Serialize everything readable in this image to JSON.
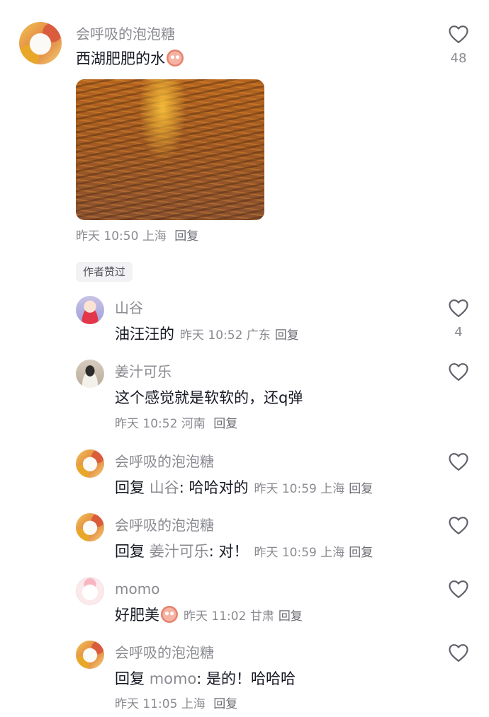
{
  "comments": [
    {
      "user": "会呼吸的泡泡糖",
      "text": "西湖肥肥的水",
      "meta": {
        "time": "昨天 10:50",
        "location": "上海",
        "reply": "回复"
      },
      "likes": "48",
      "author_tag": "作者赞过"
    },
    {
      "user": "山谷",
      "text": "油汪汪的",
      "meta": {
        "time": "昨天 10:52",
        "location": "广东",
        "reply": "回复"
      },
      "likes": "4"
    },
    {
      "user": "姜汁可乐",
      "text": "这个感觉就是软软的，还q弹",
      "meta": {
        "time": "昨天 10:52",
        "location": "河南",
        "reply": "回复"
      }
    },
    {
      "user": "会呼吸的泡泡糖",
      "reply_label": "回复",
      "reply_to": "山谷",
      "text": ": 哈哈对的",
      "meta": {
        "time": "昨天 10:59",
        "location": "上海",
        "reply": "回复"
      }
    },
    {
      "user": "会呼吸的泡泡糖",
      "reply_label": "回复",
      "reply_to": "姜汁可乐",
      "text": ": 对！",
      "meta": {
        "time": "昨天 10:59",
        "location": "上海",
        "reply": "回复"
      }
    },
    {
      "user": "momo",
      "text": "好肥美",
      "meta": {
        "time": "昨天 11:02",
        "location": "甘肃",
        "reply": "回复"
      }
    },
    {
      "user": "会呼吸的泡泡糖",
      "reply_label": "回复",
      "reply_to": "momo",
      "text": ": 是的！哈哈哈",
      "meta": {
        "time": "昨天 11:05",
        "location": "上海",
        "reply": "回复"
      }
    }
  ],
  "icons": {
    "like": "heart-outline-icon",
    "emoji": "blush-emoji-icon"
  },
  "colors": {
    "primary_text": "#161823",
    "secondary_text": "#8a8b91",
    "tag_bg": "#f2f2f4"
  }
}
